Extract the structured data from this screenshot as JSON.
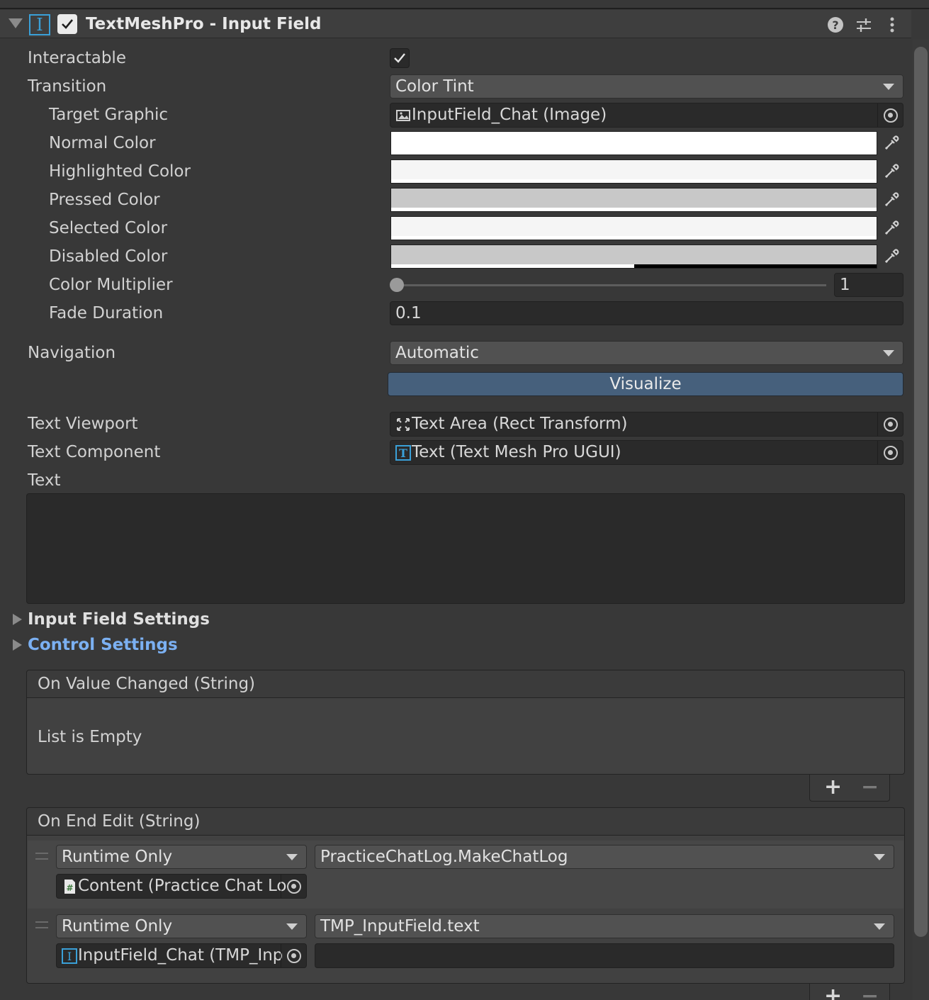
{
  "component": {
    "title": "TextMeshPro - Input Field",
    "enabled": true,
    "icon": "input-field-icon",
    "header_icons": [
      "help-icon",
      "preset-icon",
      "more-icon"
    ]
  },
  "properties": {
    "interactable_label": "Interactable",
    "interactable_checked": true,
    "transition_label": "Transition",
    "transition_value": "Color Tint",
    "target_graphic_label": "Target Graphic",
    "target_graphic_value": "InputField_Chat (Image)",
    "normal_color_label": "Normal Color",
    "highlighted_color_label": "Highlighted Color",
    "pressed_color_label": "Pressed Color",
    "selected_color_label": "Selected Color",
    "disabled_color_label": "Disabled Color",
    "color_multiplier_label": "Color Multiplier",
    "color_multiplier_value": "1",
    "fade_duration_label": "Fade Duration",
    "fade_duration_value": "0.1",
    "navigation_label": "Navigation",
    "navigation_value": "Automatic",
    "visualize_label": "Visualize",
    "text_viewport_label": "Text Viewport",
    "text_viewport_value": "Text Area (Rect Transform)",
    "text_component_label": "Text Component",
    "text_component_value": "Text (Text Mesh Pro UGUI)",
    "text_label": "Text",
    "text_value": ""
  },
  "colors": {
    "normal": "#ffffff",
    "highlighted": "#f5f5f5",
    "pressed": "#c8c8c8",
    "selected": "#f5f5f5",
    "disabled": "#c8c8c8",
    "disabled_alpha": 0.5,
    "accent_blue": "#7bb0f2",
    "visualize_bg": "#46607c"
  },
  "sections": {
    "input_field_settings": "Input Field Settings",
    "control_settings": "Control Settings"
  },
  "events": {
    "on_value_changed": {
      "title": "On Value Changed (String)",
      "empty_text": "List is Empty"
    },
    "on_end_edit": {
      "title": "On End Edit (String)",
      "listeners": [
        {
          "mode": "Runtime Only",
          "function": "PracticeChatLog.MakeChatLog",
          "object": "Content (Practice Chat Lo",
          "object_icon": "script-icon",
          "argument": ""
        },
        {
          "mode": "Runtime Only",
          "function": "TMP_InputField.text",
          "object": "InputField_Chat (TMP_Inp",
          "object_icon": "input-field-icon",
          "argument": ""
        }
      ]
    },
    "add_label": "+",
    "remove_label": "−"
  }
}
